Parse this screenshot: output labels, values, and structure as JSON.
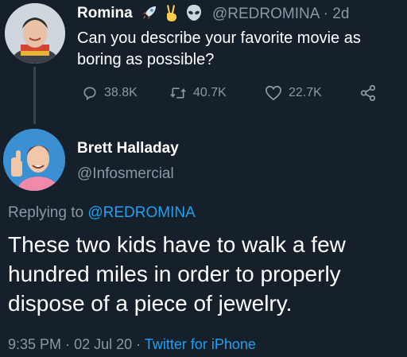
{
  "original_tweet": {
    "author_name": "Romina",
    "author_handle": "@REDROMINA",
    "age": "2d",
    "text": "Can you describe your favorite movie as boring as possible?",
    "actions": {
      "replies": "38.8K",
      "retweets": "40.7K",
      "likes": "22.7K"
    },
    "icons": [
      "rocket-emoji",
      "victory-hand-emoji",
      "alien-emoji",
      "reply-icon",
      "retweet-icon",
      "heart-icon",
      "share-icon"
    ]
  },
  "reply_tweet": {
    "author_name": "Brett Halladay",
    "author_handle": "@Infosmercial",
    "replying_prefix": "Replying to",
    "replying_handle": "@REDROMINA",
    "text": "These two kids have to walk a few hundred miles in order to properly dispose of a piece of jewelry.",
    "time": "9:35 PM",
    "date": "02 Jul 20",
    "source": "Twitter for iPhone"
  },
  "colors": {
    "background": "#15202b",
    "text": "#ffffff",
    "muted": "#8899a6",
    "link": "#1da1f2",
    "thread_line": "#38444d"
  }
}
